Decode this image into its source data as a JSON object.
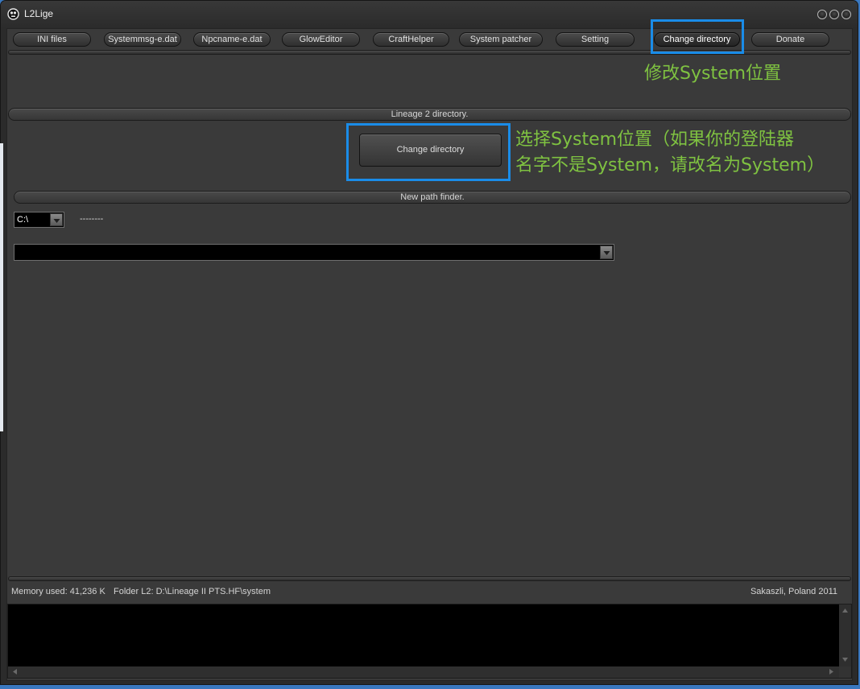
{
  "window": {
    "title": "L2Lige",
    "icon": "app-icon",
    "controls": [
      "minimize-icon",
      "maximize-icon",
      "close-icon"
    ]
  },
  "toolbar": {
    "tabs": [
      {
        "label": "INI files"
      },
      {
        "label": "Systemmsg-e.dat"
      },
      {
        "label": "Npcname-e.dat"
      },
      {
        "label": "GlowEditor"
      },
      {
        "label": "CraftHelper"
      },
      {
        "label": "System patcher"
      },
      {
        "label": "Setting"
      },
      {
        "label": "Change directory",
        "active": true
      },
      {
        "label": "Donate"
      }
    ]
  },
  "directory_section": {
    "header": "Lineage 2 directory.",
    "change_button_label": "Change directory"
  },
  "path_finder": {
    "header": "New path finder.",
    "drive_select_value": "C:\\",
    "drive_select_icon": "chevron-down-icon",
    "path_label": "--------",
    "path_select_icon": "chevron-down-icon"
  },
  "status_bar": {
    "memory": "Memory used: 41,236 K",
    "folder": "Folder L2: D:\\Lineage II PTS.HF\\system",
    "credit": "Sakaszli, Poland 2011"
  },
  "annotations": {
    "tab_note": "修改System位置",
    "button_note": [
      "选择System位置（如果你的登陆器",
      "名字不是System，请改名为System）"
    ]
  },
  "colors": {
    "annotation_text": "#7fc241",
    "annotation_box": "#1a8ce8",
    "window_bg": "#3a3a3a",
    "log_bg": "#000000"
  }
}
